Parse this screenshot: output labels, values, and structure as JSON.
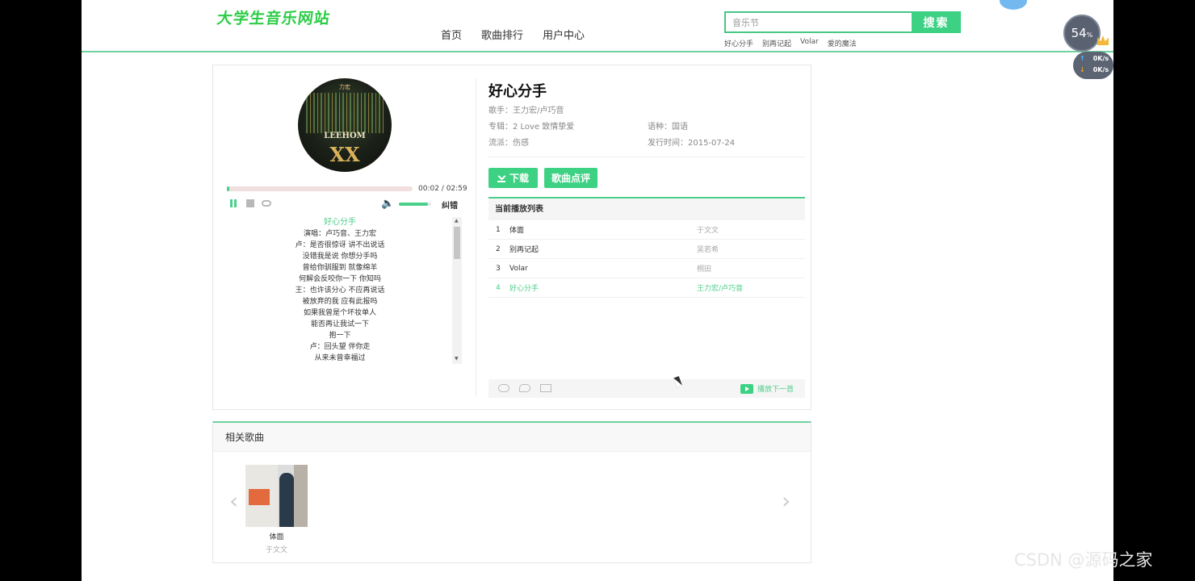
{
  "site": {
    "logo": "大学生音乐网站"
  },
  "nav": [
    {
      "label": "首页"
    },
    {
      "label": "歌曲排行"
    },
    {
      "label": "用户中心"
    }
  ],
  "search": {
    "value": "音乐节",
    "button": "搜索"
  },
  "hot_words": [
    "好心分手",
    "别再记起",
    "Volar",
    "爱的魔法"
  ],
  "speed_widget": {
    "percent": "54",
    "unit": "%",
    "upload": "0K/s",
    "download": "0K/s"
  },
  "player": {
    "cover": {
      "brand": "力宏",
      "title": "LEEHOM",
      "subtitle": "XX"
    },
    "current_time": "00:02 / 02:59",
    "progress_fraction": 0.012,
    "volume_fraction": 0.9,
    "report_label": "纠错",
    "lyrics": [
      "好心分手",
      "演唱：卢巧音、王力宏",
      "卢：是否很惊讶  讲不出说话",
      "没错我是说  你想分手吗",
      "曾给你驯服到  就像绵羊",
      "何解会反咬你一下  你知吗",
      "王：也许该分心 不应再说话",
      "被放弃的我 应有此报吗",
      "如果我曾是个坏妆单人",
      "能否再让我试一下",
      "抱一下",
      "卢：回头望  伴你走",
      "从来未曾幸福过"
    ]
  },
  "song": {
    "title": "好心分手",
    "singer": "歌手：王力宏/卢巧音",
    "album": "专辑：2 Love 致情挚爱",
    "language": "语种：国语",
    "genre": "流派：伤感",
    "release": "发行时间：2015-07-24",
    "download_label": "下载",
    "review_label": "歌曲点评"
  },
  "playlist": {
    "title": "当前播放列表",
    "rows": [
      {
        "no": "1",
        "title": "体面",
        "artist": "于文文"
      },
      {
        "no": "2",
        "title": "别再记起",
        "artist": "吴若希"
      },
      {
        "no": "3",
        "title": "Volar",
        "artist": "桐田"
      },
      {
        "no": "4",
        "title": "好心分手",
        "artist": "王力宏/卢巧音"
      }
    ],
    "active_index": 3,
    "next_label": "播放下一首"
  },
  "related": {
    "title": "相关歌曲",
    "items": [
      {
        "name": "体面",
        "artist": "于文文"
      }
    ]
  },
  "watermark": "CSDN @源码之家",
  "colors": {
    "accent": "#3dd183",
    "highlight": "#4ccf8b",
    "line": "#6fd3a0"
  }
}
